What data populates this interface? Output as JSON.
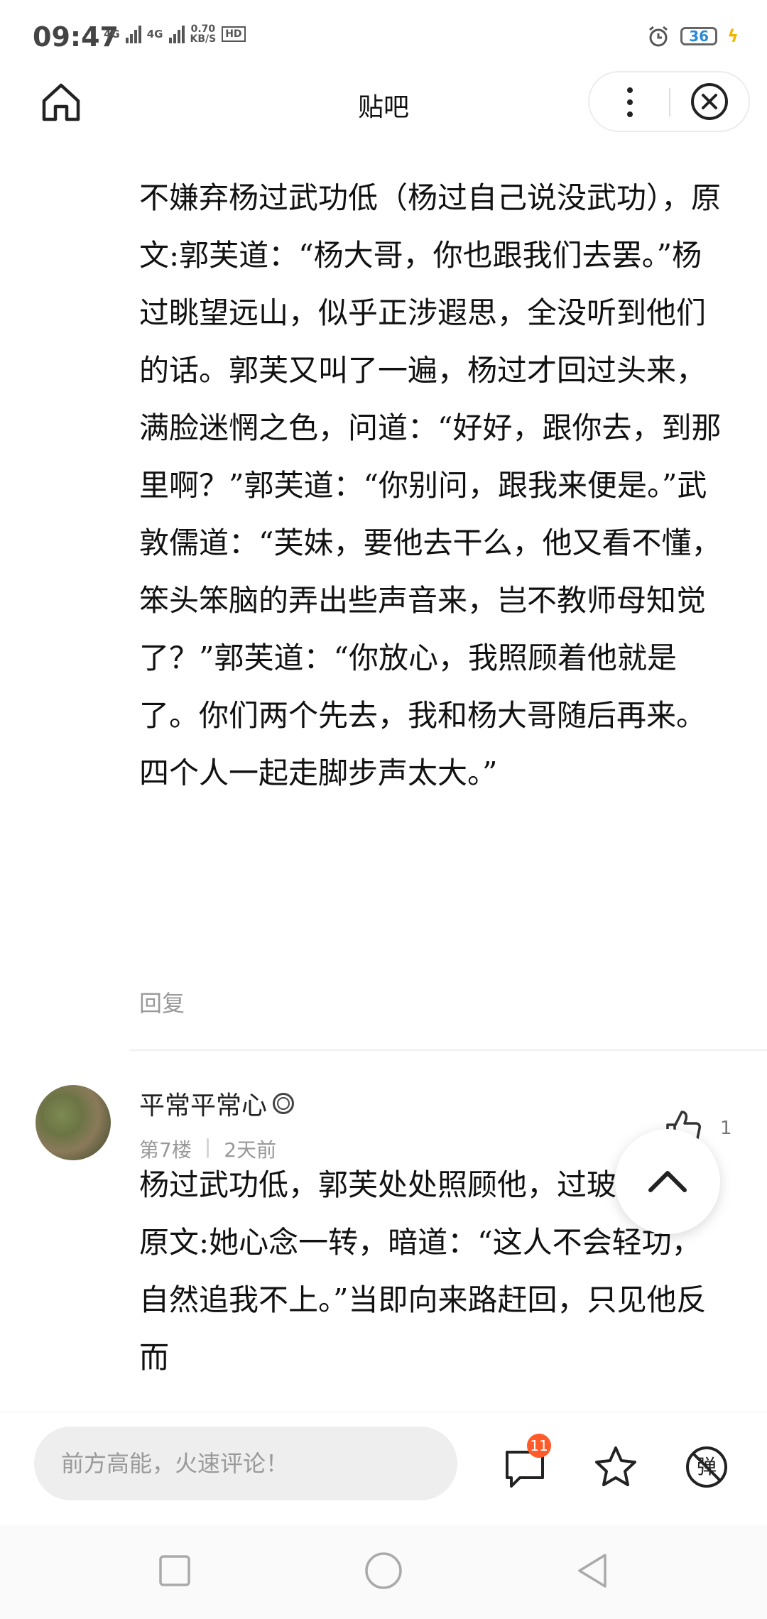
{
  "status_bar": {
    "time": "09:47",
    "net1": "4G",
    "net2": "4G",
    "speed_value": "0.70",
    "speed_unit": "KB/S",
    "hd": "HD",
    "battery": "36"
  },
  "header": {
    "title": "贴吧",
    "icons": {
      "home": "home-icon",
      "more": "more-dots-icon",
      "close": "close-icon"
    }
  },
  "post": {
    "text": "不嫌弃杨过武功低（杨过自己说没武功），原文:郭芙道：“杨大哥，你也跟我们去罢。”杨过眺望远山，似乎正涉遐思，全没听到他们的话。郭芙又叫了一遍，杨过才回过头来，满脸迷惘之色，问道：“好好，跟你去，到那里啊？”郭芙道：“你别问，跟我来便是。”武敦儒道：“芙妹，要他去干么，他又看不懂，笨头笨脑的弄出些声音来，岂不教师母知觉了？”郭芙道：“你放心，我照顾着他就是了。你们两个先去，我和杨大哥随后再来。四个人一起走脚步声太大。”",
    "reply_label": "回复"
  },
  "comment": {
    "username": "平常平常心",
    "floor": "第7楼",
    "time_ago": "2天前",
    "like_count": "1",
    "text": "杨过武功低，郭芙处处照顾他，过玻璃心，原文:她心念一转，暗道：“这人不会轻功，自然追我不上。”当即向来路赶回，只见他反而"
  },
  "bottom_bar": {
    "input_placeholder": "前方高能，火速评论！",
    "comment_badge": "11",
    "bullet_label": "弹",
    "icons": {
      "comment": "comment-icon",
      "star": "star-icon",
      "bullet": "bullet-off-icon"
    }
  },
  "colors": {
    "accent": "#ff5a2a",
    "battery_text": "#2a8ad6",
    "muted": "#999999"
  }
}
